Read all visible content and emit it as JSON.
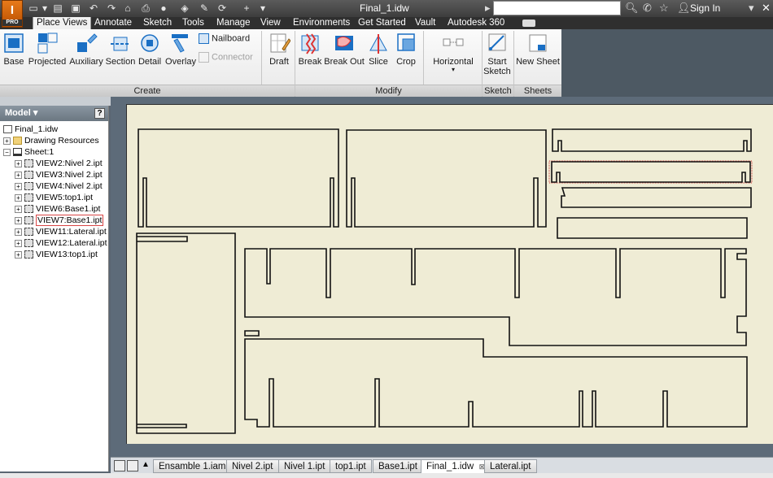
{
  "titlebar": {
    "app_logo": "I",
    "app_logo_sub": "PRO",
    "document_title": "Final_1.idw",
    "sign_in": "Sign In"
  },
  "tabs": [
    {
      "label": "Place Views",
      "active": true
    },
    {
      "label": "Annotate"
    },
    {
      "label": "Sketch"
    },
    {
      "label": "Tools"
    },
    {
      "label": "Manage"
    },
    {
      "label": "View"
    },
    {
      "label": "Environments"
    },
    {
      "label": "Get Started"
    },
    {
      "label": "Vault"
    },
    {
      "label": "Autodesk 360"
    }
  ],
  "ribbon": {
    "create": {
      "label": "Create",
      "base": "Base",
      "projected": "Projected",
      "auxiliary": "Auxiliary",
      "section": "Section",
      "detail": "Detail",
      "overlay": "Overlay",
      "nailboard": "Nailboard",
      "connector": "Connector",
      "draft": "Draft"
    },
    "modify": {
      "label": "Modify",
      "break": "Break",
      "break_out": "Break Out",
      "slice": "Slice",
      "crop": "Crop",
      "horizontal": "Horizontal"
    },
    "sketch": {
      "label": "Sketch",
      "start": "Start",
      "sketch": "Sketch"
    },
    "sheets": {
      "label": "Sheets",
      "new_sheet": "New Sheet"
    }
  },
  "browser": {
    "title": "Model",
    "help": "?",
    "items": [
      {
        "label": "Final_1.idw"
      },
      {
        "label": "Drawing Resources"
      },
      {
        "label": "Sheet:1"
      },
      {
        "label": "VIEW2:Nivel 2.ipt"
      },
      {
        "label": "VIEW3:Nivel 2.ipt"
      },
      {
        "label": "VIEW4:Nivel 2.ipt"
      },
      {
        "label": "VIEW5:top1.ipt"
      },
      {
        "label": "VIEW6:Base1.ipt"
      },
      {
        "label": "VIEW7:Base1.ipt",
        "selected": true
      },
      {
        "label": "VIEW11:Lateral.ipt"
      },
      {
        "label": "VIEW12:Lateral.ipt"
      },
      {
        "label": "VIEW13:top1.ipt"
      }
    ]
  },
  "doc_tabs": [
    {
      "label": "Ensamble 1.iam"
    },
    {
      "label": "Nivel 2.ipt"
    },
    {
      "label": "Nivel 1.ipt"
    },
    {
      "label": "top1.ipt"
    },
    {
      "label": "Base1.ipt"
    },
    {
      "label": "Final_1.idw",
      "active": true
    },
    {
      "label": "Lateral.ipt"
    }
  ],
  "colors": {
    "sheet": "#efecd5",
    "ribbon_accent": "#1a6fc4",
    "selection": "#d94646"
  }
}
